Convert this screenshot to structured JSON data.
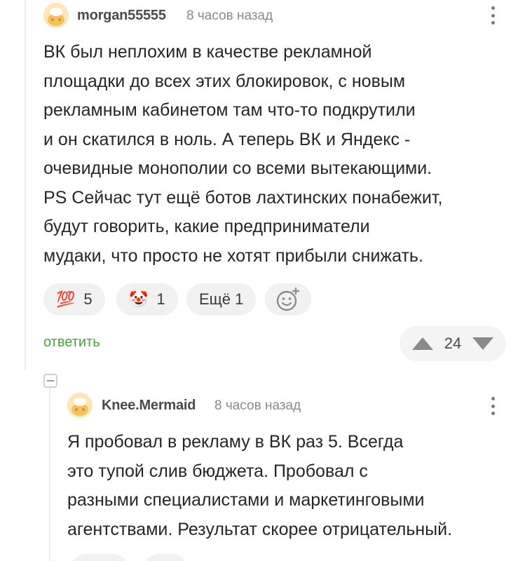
{
  "comment": {
    "username": "morgan55555",
    "time": "8 часов назад",
    "lines": [
      "ВК был неплохим в качестве рекламной",
      "площадки до всех этих блокировок, с новым",
      "рекламным кабинетом там что-то подкрутили",
      "и он скатился в ноль. А теперь ВК и Яндекс -",
      "очевидные монополии со всеми вытекающими.",
      "PS Сейчас тут ещё ботов лахтинских понабежит,",
      "будут говорить, какие предприниматели",
      "мудаки, что просто не хотят прибыли снижать."
    ],
    "reactions": [
      {
        "icon": "hundred-points-icon",
        "emoji": "💯",
        "count": "5"
      },
      {
        "icon": "clown-face-icon",
        "emoji": "🤡",
        "count": "1"
      }
    ],
    "more_reactions_label": "Ещё 1",
    "reply_label": "ответить",
    "rating": "24"
  },
  "reply": {
    "username": "Knee.Mermaid",
    "time": "8 часов назад",
    "lines": [
      "Я пробовал в рекламу в ВК раз 5. Всегда",
      "это тупой слив бюджета. Пробовал с",
      "разными специалистами и маркетинговыми",
      "агентствами. Результат скорее отрицательный."
    ]
  },
  "colors": {
    "accent_green": "#4aa33a",
    "avatar_bg": "#fde7b6",
    "pill_bg": "#f1f1f1"
  }
}
